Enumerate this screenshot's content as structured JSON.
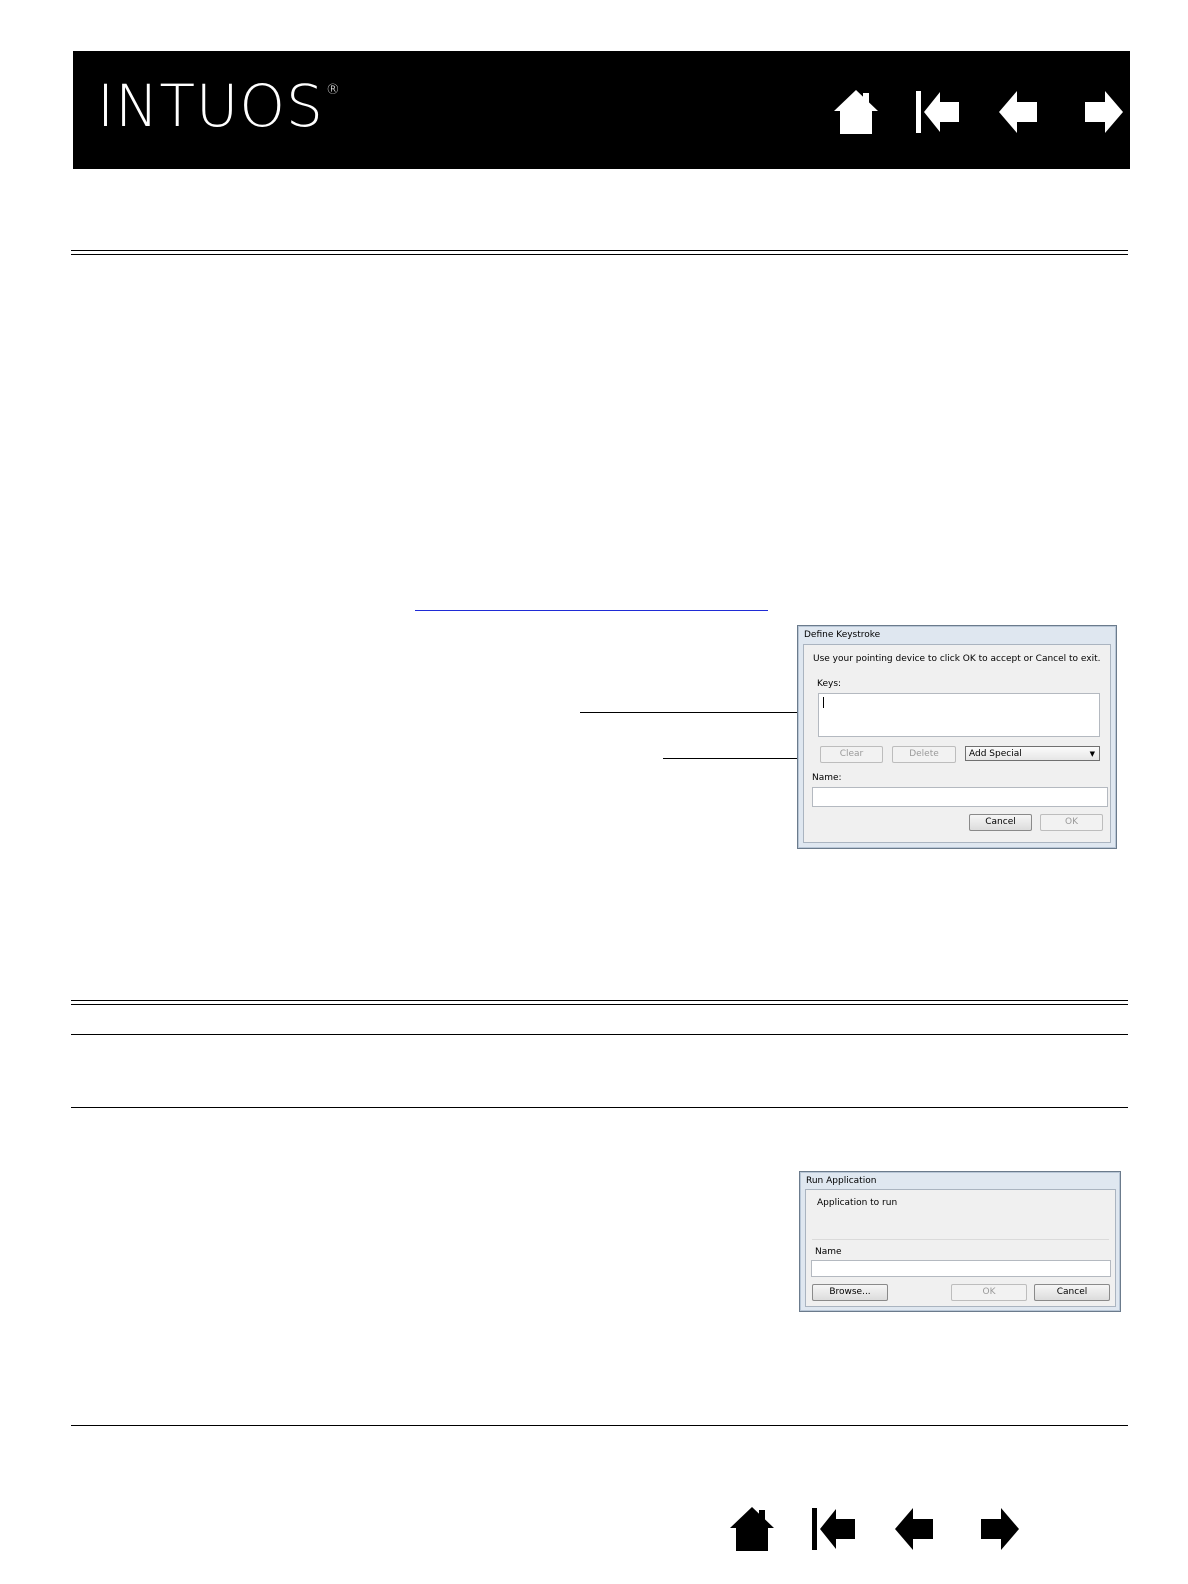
{
  "header": {
    "logo_text": "INTUOS",
    "logo_mark": "®",
    "background_color": "#000000"
  },
  "nav_icons": [
    "home-icon",
    "first-page-icon",
    "previous-page-icon",
    "next-page-icon"
  ],
  "define_keystroke_dialog": {
    "title": "Define Keystroke",
    "instruction": "Use your pointing device to click OK to accept or Cancel to exit.",
    "keys_label": "Keys:",
    "clear_label": "Clear",
    "delete_label": "Delete",
    "add_special_label": "Add Special",
    "name_label": "Name:",
    "cancel_label": "Cancel",
    "ok_label": "OK"
  },
  "run_application_dialog": {
    "title": "Run Application",
    "application_label": "Application to run",
    "name_label": "Name",
    "browse_label": "Browse...",
    "ok_label": "OK",
    "cancel_label": "Cancel"
  }
}
